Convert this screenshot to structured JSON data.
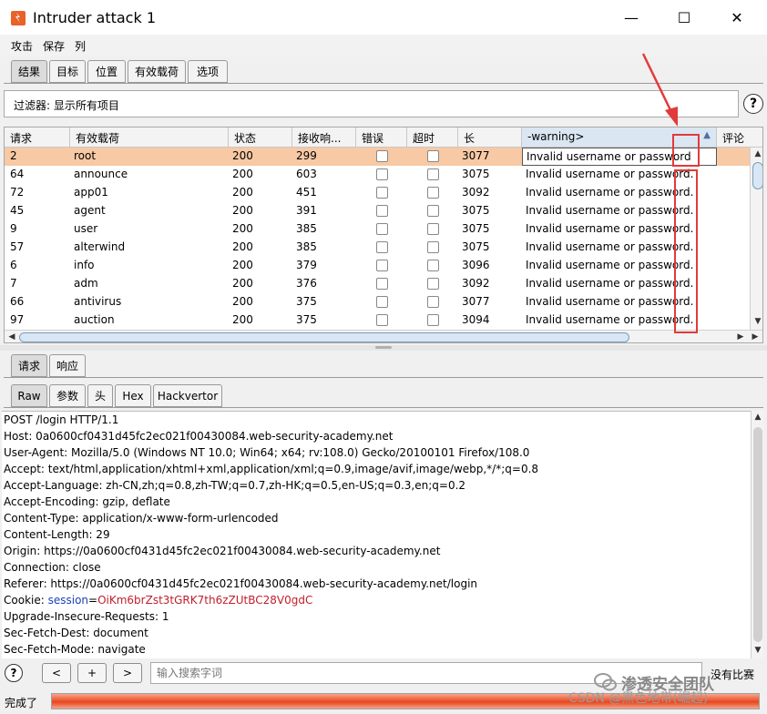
{
  "window": {
    "title": "Intruder attack 1",
    "minimize_glyph": "—",
    "maximize_glyph": "☐",
    "close_glyph": "✕"
  },
  "menu": [
    "攻击",
    "保存",
    "列"
  ],
  "top_tabs": [
    {
      "label": "结果",
      "active": true
    },
    {
      "label": "目标",
      "active": false
    },
    {
      "label": "位置",
      "active": false
    },
    {
      "label": "有效载荷",
      "active": false
    },
    {
      "label": "选项",
      "active": false
    }
  ],
  "filter": {
    "label": "过滤器: 显示所有项目"
  },
  "help_glyph": "?",
  "table": {
    "columns": [
      "请求",
      "有效载荷",
      "状态",
      "接收响...",
      "错误",
      "超时",
      "长",
      "-warning>",
      "评论"
    ],
    "sort_glyph": "▲",
    "rows": [
      {
        "req": "2",
        "payload": "root",
        "status": "200",
        "recv": "299",
        "length": "3077",
        "warning": "Invalid username or password",
        "selected": true
      },
      {
        "req": "64",
        "payload": "announce",
        "status": "200",
        "recv": "603",
        "length": "3075",
        "warning": "Invalid username or password."
      },
      {
        "req": "72",
        "payload": "app01",
        "status": "200",
        "recv": "451",
        "length": "3092",
        "warning": "Invalid username or password."
      },
      {
        "req": "45",
        "payload": "agent",
        "status": "200",
        "recv": "391",
        "length": "3075",
        "warning": "Invalid username or password."
      },
      {
        "req": "9",
        "payload": "user",
        "status": "200",
        "recv": "385",
        "length": "3075",
        "warning": "Invalid username or password."
      },
      {
        "req": "57",
        "payload": "alterwind",
        "status": "200",
        "recv": "385",
        "length": "3075",
        "warning": "Invalid username or password."
      },
      {
        "req": "6",
        "payload": "info",
        "status": "200",
        "recv": "379",
        "length": "3096",
        "warning": "Invalid username or password."
      },
      {
        "req": "7",
        "payload": "adm",
        "status": "200",
        "recv": "376",
        "length": "3092",
        "warning": "Invalid username or password."
      },
      {
        "req": "66",
        "payload": "antivirus",
        "status": "200",
        "recv": "375",
        "length": "3077",
        "warning": "Invalid username or password."
      },
      {
        "req": "97",
        "payload": "auction",
        "status": "200",
        "recv": "375",
        "length": "3094",
        "warning": "Invalid username or password."
      }
    ]
  },
  "lower_tabs": [
    {
      "label": "请求",
      "active": true
    },
    {
      "label": "响应",
      "active": false
    }
  ],
  "view_tabs": [
    {
      "label": "Raw",
      "active": true
    },
    {
      "label": "参数",
      "active": false
    },
    {
      "label": "头",
      "active": false
    },
    {
      "label": "Hex",
      "active": false
    },
    {
      "label": "Hackvertor",
      "active": false
    }
  ],
  "request_lines": [
    "POST /login HTTP/1.1",
    "Host: 0a0600cf0431d45fc2ec021f00430084.web-security-academy.net",
    "User-Agent: Mozilla/5.0 (Windows NT 10.0; Win64; x64; rv:108.0) Gecko/20100101 Firefox/108.0",
    "Accept: text/html,application/xhtml+xml,application/xml;q=0.9,image/avif,image/webp,*/*;q=0.8",
    "Accept-Language: zh-CN,zh;q=0.8,zh-TW;q=0.7,zh-HK;q=0.5,en-US;q=0.3,en;q=0.2",
    "Accept-Encoding: gzip, deflate",
    "Content-Type: application/x-www-form-urlencoded",
    "Content-Length: 29",
    "Origin: https://0a0600cf0431d45fc2ec021f00430084.web-security-academy.net",
    "Connection: close",
    "Referer: https://0a0600cf0431d45fc2ec021f00430084.web-security-academy.net/login"
  ],
  "cookie_line": {
    "prefix": "Cookie: ",
    "name": "session",
    "eq": "=",
    "value": "OiKm6brZst3tGRK7th6zZUtBC28V0gdC"
  },
  "request_lines_after": [
    "Upgrade-Insecure-Requests: 1",
    "Sec-Fetch-Dest: document",
    "Sec-Fetch-Mode: navigate"
  ],
  "search": {
    "prev_glyph": "<",
    "add_glyph": "+",
    "next_glyph": ">",
    "placeholder": "输入搜索字词",
    "match_label": "没有比赛"
  },
  "status": {
    "label": "完成了",
    "progress": 1.0
  },
  "watermark": {
    "line1": "渗透安全团队",
    "line2": "CSDN @黑色地带(崛起)"
  },
  "colors": {
    "selected_row": "#f7c9a5",
    "progress": "#e8461f",
    "annotation": "#e23a3a",
    "cookie_name": "#1d3fb8",
    "cookie_value": "#c0202c"
  }
}
